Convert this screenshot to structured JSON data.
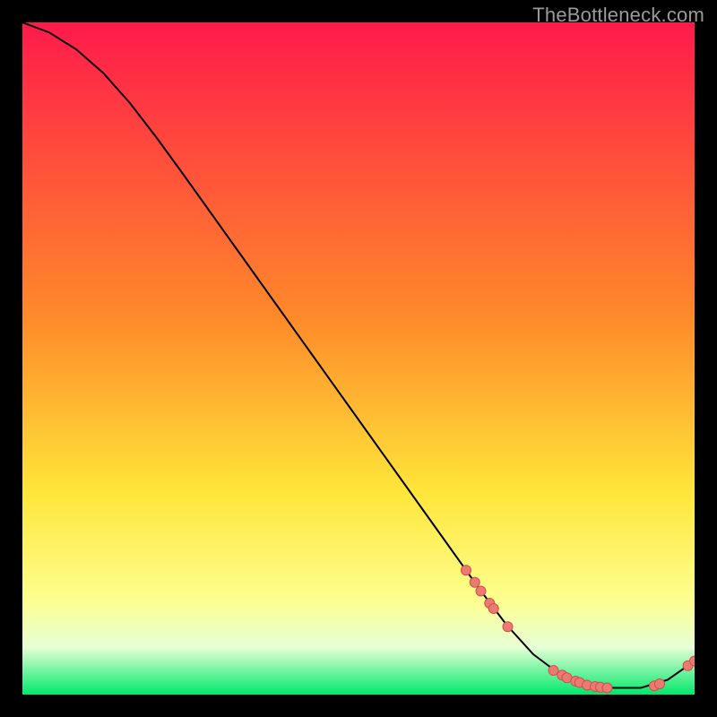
{
  "watermark": "TheBottleneck.com",
  "colors": {
    "grad_top": "#ff1a4b",
    "grad_orange": "#ff8a2a",
    "grad_yellow": "#ffe63a",
    "grad_light": "#fdff8f",
    "grad_pale": "#e6ffd6",
    "grad_green": "#00e86b",
    "curve": "#000000",
    "marker_fill": "#ed7a72",
    "marker_stroke": "#cf514a",
    "frame": "#000000"
  },
  "chart_data": {
    "type": "line",
    "title": "",
    "xlabel": "",
    "ylabel": "",
    "xlim": [
      0,
      100
    ],
    "ylim": [
      0,
      100
    ],
    "curve": [
      {
        "x": 0,
        "y": 100
      },
      {
        "x": 4,
        "y": 98.5
      },
      {
        "x": 8,
        "y": 96
      },
      {
        "x": 12,
        "y": 92.5
      },
      {
        "x": 16,
        "y": 88
      },
      {
        "x": 20,
        "y": 82.8
      },
      {
        "x": 24,
        "y": 77.3
      },
      {
        "x": 28,
        "y": 71.7
      },
      {
        "x": 32,
        "y": 66.1
      },
      {
        "x": 36,
        "y": 60.5
      },
      {
        "x": 40,
        "y": 54.9
      },
      {
        "x": 44,
        "y": 49.3
      },
      {
        "x": 48,
        "y": 43.7
      },
      {
        "x": 52,
        "y": 38.1
      },
      {
        "x": 56,
        "y": 32.5
      },
      {
        "x": 60,
        "y": 26.9
      },
      {
        "x": 64,
        "y": 21.3
      },
      {
        "x": 68,
        "y": 15.7
      },
      {
        "x": 72,
        "y": 10.4
      },
      {
        "x": 76,
        "y": 6.0
      },
      {
        "x": 80,
        "y": 3.0
      },
      {
        "x": 84,
        "y": 1.4
      },
      {
        "x": 88,
        "y": 1.0
      },
      {
        "x": 92,
        "y": 1.0
      },
      {
        "x": 96,
        "y": 2.2
      },
      {
        "x": 100,
        "y": 5.0
      }
    ],
    "markers": [
      {
        "x": 66.0,
        "y": 18.5
      },
      {
        "x": 67.3,
        "y": 16.7
      },
      {
        "x": 68.2,
        "y": 15.4
      },
      {
        "x": 69.5,
        "y": 13.6
      },
      {
        "x": 70.1,
        "y": 12.8
      },
      {
        "x": 72.2,
        "y": 10.1
      },
      {
        "x": 79.0,
        "y": 3.6
      },
      {
        "x": 80.3,
        "y": 2.9
      },
      {
        "x": 81.0,
        "y": 2.5
      },
      {
        "x": 82.3,
        "y": 2.0
      },
      {
        "x": 82.9,
        "y": 1.8
      },
      {
        "x": 84.0,
        "y": 1.4
      },
      {
        "x": 85.2,
        "y": 1.2
      },
      {
        "x": 86.0,
        "y": 1.1
      },
      {
        "x": 87.0,
        "y": 1.0
      },
      {
        "x": 94.0,
        "y": 1.3
      },
      {
        "x": 94.8,
        "y": 1.6
      },
      {
        "x": 99.0,
        "y": 4.3
      },
      {
        "x": 100.0,
        "y": 5.0
      }
    ],
    "gradient_stops": [
      {
        "pct": 0,
        "key": "grad_top"
      },
      {
        "pct": 44,
        "key": "grad_orange"
      },
      {
        "pct": 70,
        "key": "grad_yellow"
      },
      {
        "pct": 86,
        "key": "grad_light"
      },
      {
        "pct": 93,
        "key": "grad_pale"
      },
      {
        "pct": 100,
        "key": "grad_green"
      }
    ]
  }
}
